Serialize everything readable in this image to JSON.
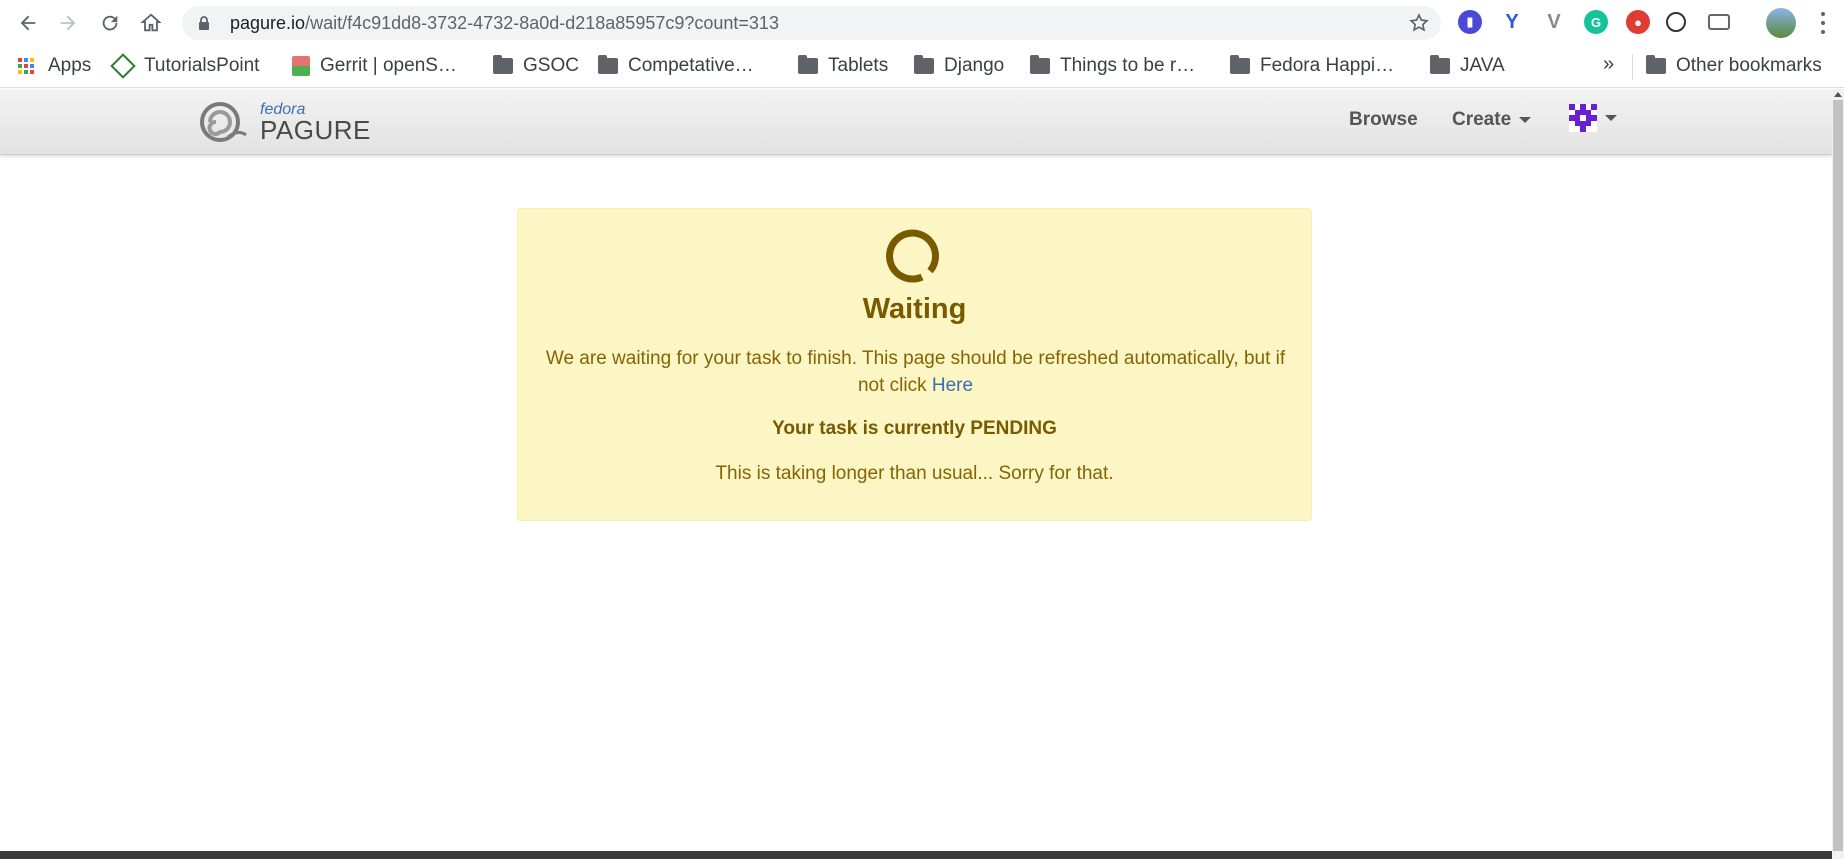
{
  "browser": {
    "url_host": "pagure.io",
    "url_path": "/wait/f4c91dd8-3732-4732-8a0d-d218a85957c9?count=313",
    "bookmarks": [
      {
        "label": "Apps",
        "icon": "apps-grid-icon"
      },
      {
        "label": "TutorialsPoint",
        "icon": "tutorialspoint-icon"
      },
      {
        "label": "Gerrit | openS…",
        "icon": "gerrit-icon"
      },
      {
        "label": "GSOC",
        "icon": "folder-icon"
      },
      {
        "label": "Competative…",
        "icon": "folder-icon"
      },
      {
        "label": "Tablets",
        "icon": "folder-icon"
      },
      {
        "label": "Django",
        "icon": "folder-icon"
      },
      {
        "label": "Things to be r…",
        "icon": "folder-icon"
      },
      {
        "label": "Fedora Happi…",
        "icon": "folder-icon"
      },
      {
        "label": "JAVA",
        "icon": "folder-icon"
      }
    ],
    "overflow_label": "»",
    "other_bookmarks": "Other bookmarks"
  },
  "header": {
    "logo_small": "fedora",
    "logo_large": "PAGURE",
    "nav_browse": "Browse",
    "nav_create": "Create"
  },
  "waiting": {
    "title": "Waiting",
    "message": "We are waiting for your task to finish. This page should be refreshed automatically, but if not click",
    "link_text": "Here",
    "status": "Your task is currently PENDING",
    "sorry": "This is taking longer than usual... Sorry for that."
  },
  "colors": {
    "alert_bg": "#fcf6c5",
    "alert_text": "#856404",
    "link": "#3c6eb4",
    "avatar": "#6a1fd1"
  }
}
